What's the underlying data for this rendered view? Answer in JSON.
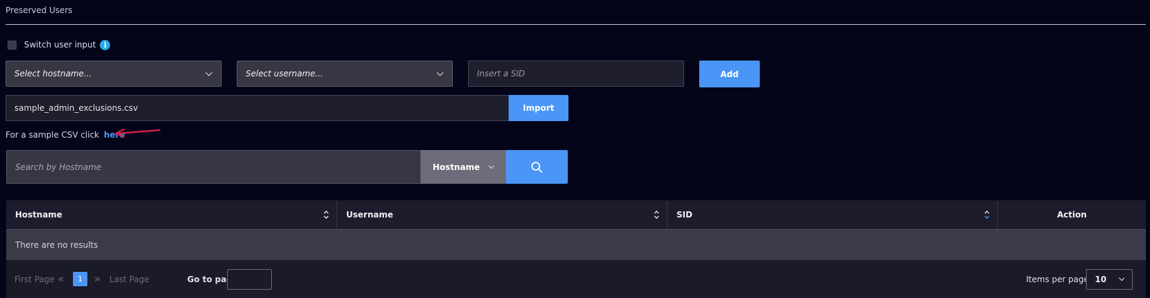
{
  "section": {
    "title": "Preserved Users"
  },
  "switch": {
    "label": "Switch user input",
    "info_glyph": "i"
  },
  "inputs": {
    "hostname_placeholder": "Select hostname...",
    "username_placeholder": "Select username...",
    "sid_placeholder": "Insert a SID",
    "add_label": "Add"
  },
  "import": {
    "file_name": "sample_admin_exclusions.csv",
    "button_label": "Import"
  },
  "sample": {
    "text": "For a sample CSV click",
    "link": "here"
  },
  "search": {
    "placeholder": "Search by Hostname",
    "field_selected": "Hostname"
  },
  "table": {
    "columns": [
      "Hostname",
      "Username",
      "SID",
      "Action"
    ],
    "empty_message": "There are no results"
  },
  "pagination": {
    "first_label": "First Page",
    "last_label": "Last Page",
    "current_page": "1",
    "goto_label": "Go to page:",
    "items_per_page_label": "Items per page:",
    "items_per_page_value": "10"
  },
  "colors": {
    "background": "#05051a",
    "accent": "#4a95f5",
    "annotation_arrow": "#e0204a"
  },
  "icons": {
    "info": "info-icon",
    "search": "search-icon",
    "sort": "sort-icon",
    "chevron": "chevron-down-icon"
  }
}
